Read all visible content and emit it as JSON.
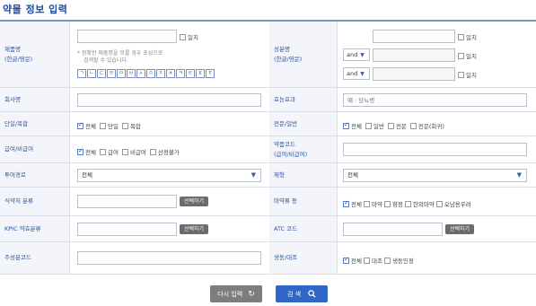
{
  "page_title": "약물 정보 입력",
  "product_name": {
    "label_line1": "제품명",
    "label_line2": "(한글/영문)",
    "exact_label": "일치",
    "note_line1": "* 정확한 제품명을 모를 경우 초성으로",
    "note_line2": "검색할 수 있습니다.",
    "consonants": [
      "ㄱ",
      "ㄴ",
      "ㄷ",
      "ㄹ",
      "ㅁ",
      "ㅂ",
      "ㅅ",
      "ㅇ",
      "ㅈ",
      "ㅊ",
      "ㅋ",
      "ㅌ",
      "ㅍ",
      "ㅎ"
    ]
  },
  "ingredient": {
    "label_line1": "성분명",
    "label_line2": "(한글/영문)",
    "exact_label": "일치",
    "and_label": "and"
  },
  "company": {
    "label": "회사명"
  },
  "efficacy": {
    "label": "효능효과",
    "placeholder": "예 : 당뇨병"
  },
  "single_combo": {
    "label": "단일/복합",
    "options": [
      "전체",
      "단일",
      "복합"
    ]
  },
  "pro_general": {
    "label": "전문/일반",
    "options": [
      "전체",
      "일반",
      "전문",
      "전문(회귀)"
    ]
  },
  "coverage": {
    "label": "급여/비급여",
    "options": [
      "전체",
      "급여",
      "비급여",
      "산정불가"
    ]
  },
  "drug_code": {
    "label_line1": "약품코드",
    "label_line2": "(급여/비급여)"
  },
  "route": {
    "label": "투여경로",
    "value": "전체"
  },
  "dosage_form": {
    "label": "제형",
    "value": "전체"
  },
  "appearance": {
    "label": "식약처 분류",
    "select_button": "선택하기"
  },
  "narcotics": {
    "label": "마약류 등",
    "options": [
      "전체",
      "마약",
      "향정",
      "한외마약",
      "오남용우려"
    ]
  },
  "kpic": {
    "label": "KPIC 약효분류",
    "select_button": "선택하기"
  },
  "atc": {
    "label": "ATC 코드",
    "select_button": "선택하기"
  },
  "main_code": {
    "label": "주성분코드"
  },
  "biologic": {
    "label": "생동/대조",
    "options": [
      "전체",
      "대조",
      "생동인정"
    ]
  },
  "buttons": {
    "reset": "다시 입력",
    "search": "검 색"
  }
}
